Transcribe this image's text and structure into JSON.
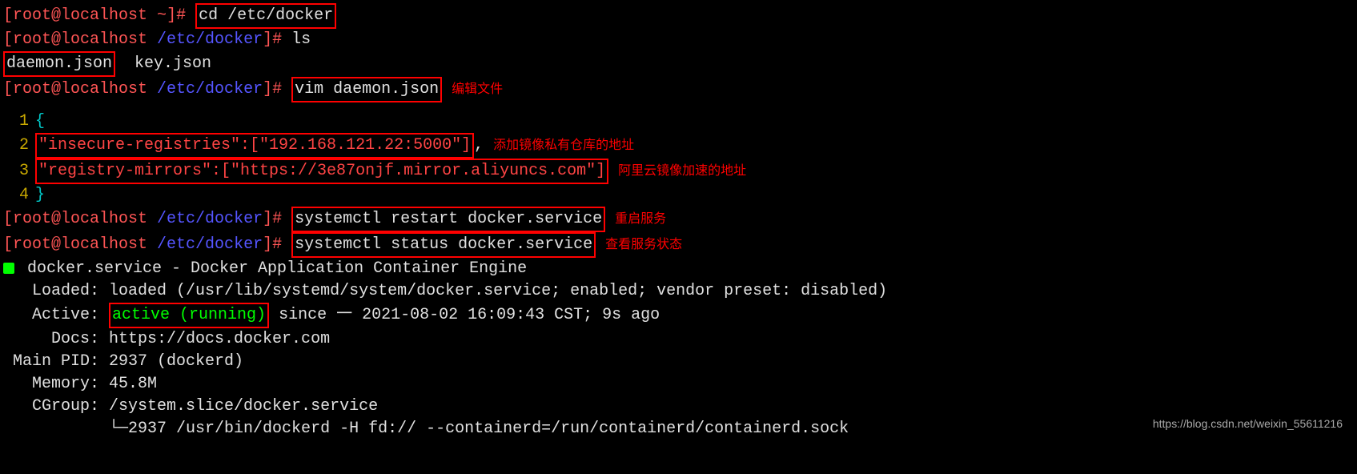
{
  "prompt1": {
    "left_bracket": "[",
    "user_host": "root@localhost ",
    "path": "~",
    "right_bracket": "]# ",
    "cmd": "cd /etc/docker"
  },
  "prompt2": {
    "left_bracket": "[",
    "user_host": "root@localhost ",
    "path": "/etc/docker",
    "right_bracket": "]# ",
    "cmd": "ls"
  },
  "ls_output": {
    "file1": "daemon.json",
    "spacer": "  ",
    "file2": "key.json"
  },
  "prompt3": {
    "left_bracket": "[",
    "user_host": "root@localhost ",
    "path": "/etc/docker",
    "right_bracket": "]# ",
    "cmd": "vim daemon.json",
    "annotation": "编辑文件"
  },
  "json_content": {
    "line1_num": "1",
    "line1": "{",
    "line2_num": "2",
    "line2_part1": "\"insecure-registries\":[\"192.168.121.22:5000\"]",
    "line2_comma": ",",
    "line2_annotation": "添加镜像私有仓库的地址",
    "line3_num": "3",
    "line3_part1": "\"registry-mirrors\":[\"https://3e87onjf.mirror.aliyuncs.com\"]",
    "line3_annotation": "阿里云镜像加速的地址",
    "line4_num": "4",
    "line4": "}"
  },
  "prompt4": {
    "left_bracket": "[",
    "user_host": "root@localhost ",
    "path": "/etc/docker",
    "right_bracket": "]# ",
    "cmd": "systemctl restart docker.service",
    "annotation": "重启服务"
  },
  "prompt5": {
    "left_bracket": "[",
    "user_host": "root@localhost ",
    "path": "/etc/docker",
    "right_bracket": "]# ",
    "cmd": "systemctl status docker.service",
    "annotation": "查看服务状态"
  },
  "status": {
    "line1": " docker.service - Docker Application Container Engine",
    "line2": "   Loaded: loaded (/usr/lib/systemd/system/docker.service; enabled; vendor preset: disabled)",
    "line3_prefix": "   Active: ",
    "line3_active": "active (running)",
    "line3_suffix": " since 一 2021-08-02 16:09:43 CST; 9s ago",
    "line4": "     Docs: https://docs.docker.com",
    "line5": " Main PID: 2937 (dockerd)",
    "line6": "   Memory: 45.8M",
    "line7": "   CGroup: /system.slice/docker.service",
    "line8": "           └─2937 /usr/bin/dockerd -H fd:// --containerd=/run/containerd/containerd.sock"
  },
  "watermark": "https://blog.csdn.net/weixin_55611216"
}
